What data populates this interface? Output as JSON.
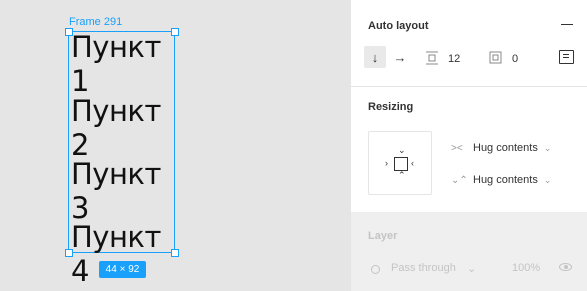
{
  "canvas": {
    "frame_label": "Frame 291",
    "items": [
      "Пункт 1",
      "Пункт 2",
      "Пункт 3",
      "Пункт 4"
    ],
    "size_badge": "44 × 92"
  },
  "panel": {
    "auto_layout": {
      "title": "Auto layout",
      "direction_vertical_icon": "↓",
      "direction_horizontal_icon": "→",
      "spacing_value": "12",
      "padding_value": "0"
    },
    "resizing": {
      "title": "Resizing",
      "horizontal": "Hug contents",
      "vertical": "Hug contents"
    },
    "layer": {
      "title": "Layer",
      "blend_mode": "Pass through",
      "opacity": "100%"
    }
  },
  "colors": {
    "selection": "#18a0fb",
    "canvas_bg": "#e5e5e5",
    "panel_bg": "#ffffff"
  }
}
